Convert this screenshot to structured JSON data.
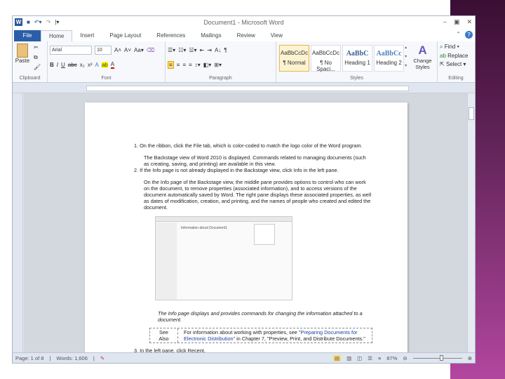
{
  "window": {
    "title": "Document1 - Microsoft Word",
    "min": "–",
    "max": "▣",
    "close": "✕"
  },
  "tabs": [
    {
      "label": "File"
    },
    {
      "label": "Home"
    },
    {
      "label": "Insert"
    },
    {
      "label": "Page Layout"
    },
    {
      "label": "References"
    },
    {
      "label": "Mailings"
    },
    {
      "label": "Review"
    },
    {
      "label": "View"
    }
  ],
  "ribbon": {
    "clipboard": {
      "label": "Clipboard",
      "paste": "Paste"
    },
    "font": {
      "label": "Font",
      "name": "Arial",
      "size": "10"
    },
    "paragraph": {
      "label": "Paragraph"
    },
    "styles": {
      "label": "Styles",
      "items": [
        {
          "preview": "AaBbCcDc",
          "name": "¶ Normal"
        },
        {
          "preview": "AaBbCcDc",
          "name": "¶ No Spaci..."
        },
        {
          "preview": "AaBbC",
          "name": "Heading 1"
        },
        {
          "preview": "AaBbCc",
          "name": "Heading 2"
        }
      ],
      "change": "Change Styles"
    },
    "editing": {
      "label": "Editing",
      "find": "Find",
      "replace": "Replace",
      "select": "Select"
    }
  },
  "doc": {
    "step1": "1. On the ribbon, click the File tab, which is color-coded to match the logo color of the Word program.",
    "step1_note": "The Backstage view of Word 2010 is displayed. Commands related to managing documents (such as creating, saving, and printing) are available in this view.",
    "step2": "2. If the Info page is not already displayed in the Backstage view, click Info in the left pane.",
    "step2_note": "On the Info page of the Backstage view, the middle pane provides options to control who can work on the document, to remove properties (associated information), and to access versions of the document automatically saved by Word. The right pane displays these associated properties, as well as dates of modification, creation, and printing, and the names of people who created and edited the document.",
    "screenshot_title": "Information about Document1",
    "caption": "The Info page displays and provides commands for changing the information attached to a document.",
    "see_also_label": "See Also",
    "see_also_pre": "For information about working with properties, see ",
    "see_also_link": "\"Preparing Documents for Electronic Distribution\"",
    "see_also_post": " in Chapter 7, \"Preview, Print, and Distribute Documents.\"",
    "step3": "3. In the left pane, click Recent."
  },
  "status": {
    "page": "Page: 1 of 8",
    "words": "Words: 1,606",
    "zoom": "87%",
    "zoom_level": 87
  },
  "colors": {
    "file_tab": "#2a5ea8",
    "purple_top": "#3a0e34",
    "purple_bottom": "#b2469f"
  }
}
